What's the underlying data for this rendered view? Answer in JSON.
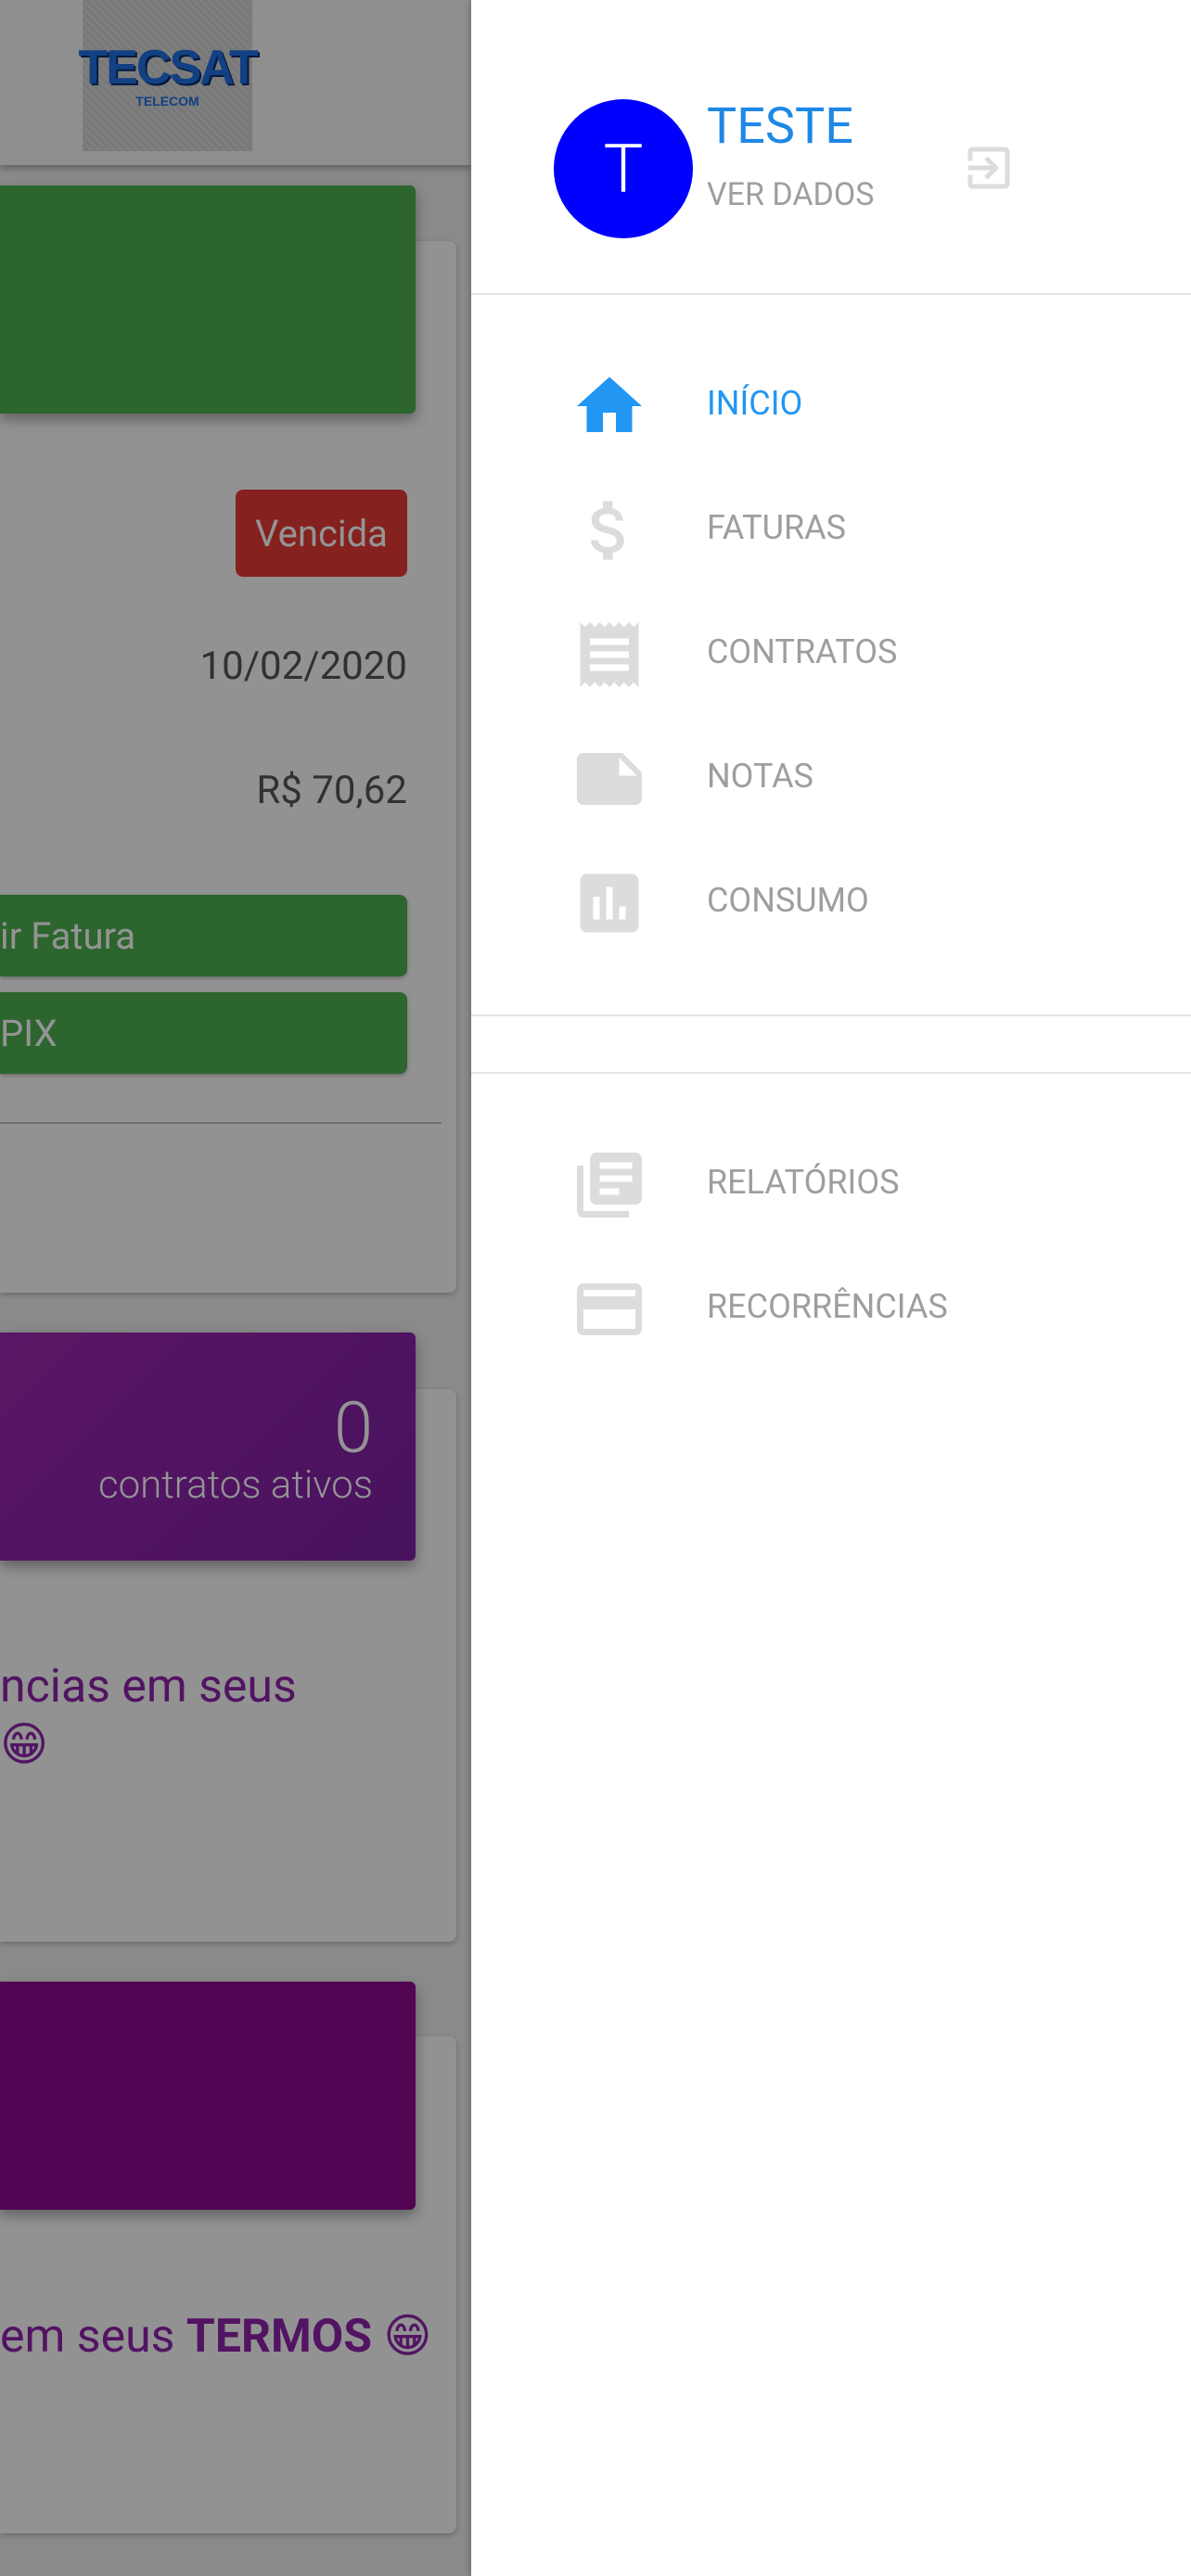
{
  "background": {
    "logo": {
      "main": "TECSAT",
      "sub": "TELECOM"
    },
    "invoice_card": {
      "status_badge": "Vencida",
      "due_date": "10/02/2020",
      "amount": "R$ 70,62",
      "buttons": [
        "ir Fatura",
        "PIX"
      ]
    },
    "contracts_card": {
      "count": "0",
      "count_label": "contratos ativos",
      "message_line1": "ncias em seus",
      "message_line2": "😁"
    },
    "terms_card": {
      "message_prefix": "em seus ",
      "message_bold": "TERMOS",
      "message_suffix": " 😁"
    }
  },
  "drawer": {
    "avatar_letter": "T",
    "user_name": "TESTE",
    "user_sub": "VER DADOS",
    "menu_primary": [
      {
        "label": "INÍCIO",
        "icon": "home-icon",
        "active": true
      },
      {
        "label": "FATURAS",
        "icon": "dollar-icon",
        "active": false
      },
      {
        "label": "CONTRATOS",
        "icon": "receipt-icon",
        "active": false
      },
      {
        "label": "NOTAS",
        "icon": "note-icon",
        "active": false
      },
      {
        "label": "CONSUMO",
        "icon": "bar-chart-icon",
        "active": false
      }
    ],
    "menu_secondary": [
      {
        "label": "RELATÓRIOS",
        "icon": "library-books-icon"
      },
      {
        "label": "RECORRÊNCIAS",
        "icon": "credit-card-icon"
      }
    ]
  },
  "colors": {
    "accent": "#2196f3",
    "avatar": "#0000ff",
    "inactive": "#9e9e9e",
    "icon_inactive": "#dcdcdc"
  }
}
